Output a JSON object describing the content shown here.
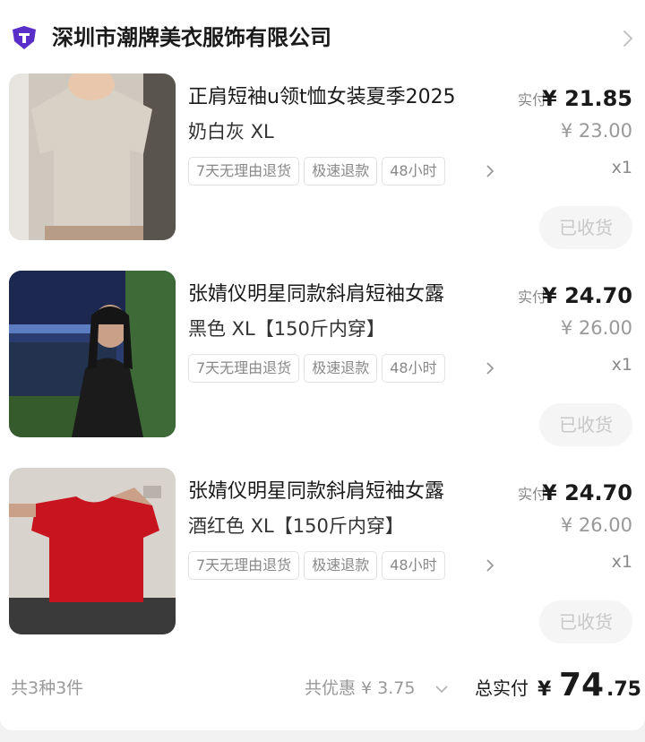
{
  "store": {
    "name": "深圳市潮牌美衣服饰有限公司",
    "logo_icon": "store-logo-icon",
    "chevron_icon": "chevron-right-icon"
  },
  "items": [
    {
      "title": "正肩短袖u领t恤女装夏季2025",
      "spec": "奶白灰 XL",
      "tags": [
        "7天无理由退货",
        "极速退款",
        "48小时"
      ],
      "paid_label": "实付",
      "paid_price": "¥ 21.85",
      "original_price": "¥ 23.00",
      "quantity": "x1",
      "status_button": "已收货",
      "image_color": "#d8d2c6"
    },
    {
      "title": "张婧仪明星同款斜肩短袖女露",
      "spec": "黑色 XL【150斤内穿】",
      "tags": [
        "7天无理由退货",
        "极速退款",
        "48小时"
      ],
      "paid_label": "实付",
      "paid_price": "¥ 24.70",
      "original_price": "¥ 26.00",
      "quantity": "x1",
      "status_button": "已收货",
      "image_color": "#1b1b1b"
    },
    {
      "title": "张婧仪明星同款斜肩短袖女露",
      "spec": "酒红色 XL【150斤内穿】",
      "tags": [
        "7天无理由退货",
        "极速退款",
        "48小时"
      ],
      "paid_label": "实付",
      "paid_price": "¥ 24.70",
      "original_price": "¥ 26.00",
      "quantity": "x1",
      "status_button": "已收货",
      "image_color": "#c8141e"
    }
  ],
  "footer": {
    "count": "共3种3件",
    "discount": "共优惠 ¥ 3.75",
    "total_label": "总实付",
    "total_currency": "¥",
    "total_integer": "74",
    "total_decimal": ".75"
  },
  "colors": {
    "accent_logo": "#5a2ec8",
    "price_text": "#1a1a1a",
    "muted_text": "#999999"
  }
}
